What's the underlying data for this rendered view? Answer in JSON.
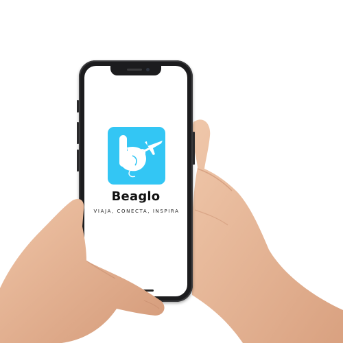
{
  "app": {
    "brand_name": "Beaglo",
    "tagline": "VIAJA, CONECTA, INSPIRA",
    "logo_icon": "airplane-b-icon"
  },
  "colors": {
    "logo_background": "#33c6f4",
    "logo_foreground": "#ffffff",
    "text": "#111111",
    "phone_body": "#1c1c1e",
    "skin": "#e8b99a"
  },
  "device": {
    "type": "smartphone",
    "screen": "splash-screen"
  }
}
